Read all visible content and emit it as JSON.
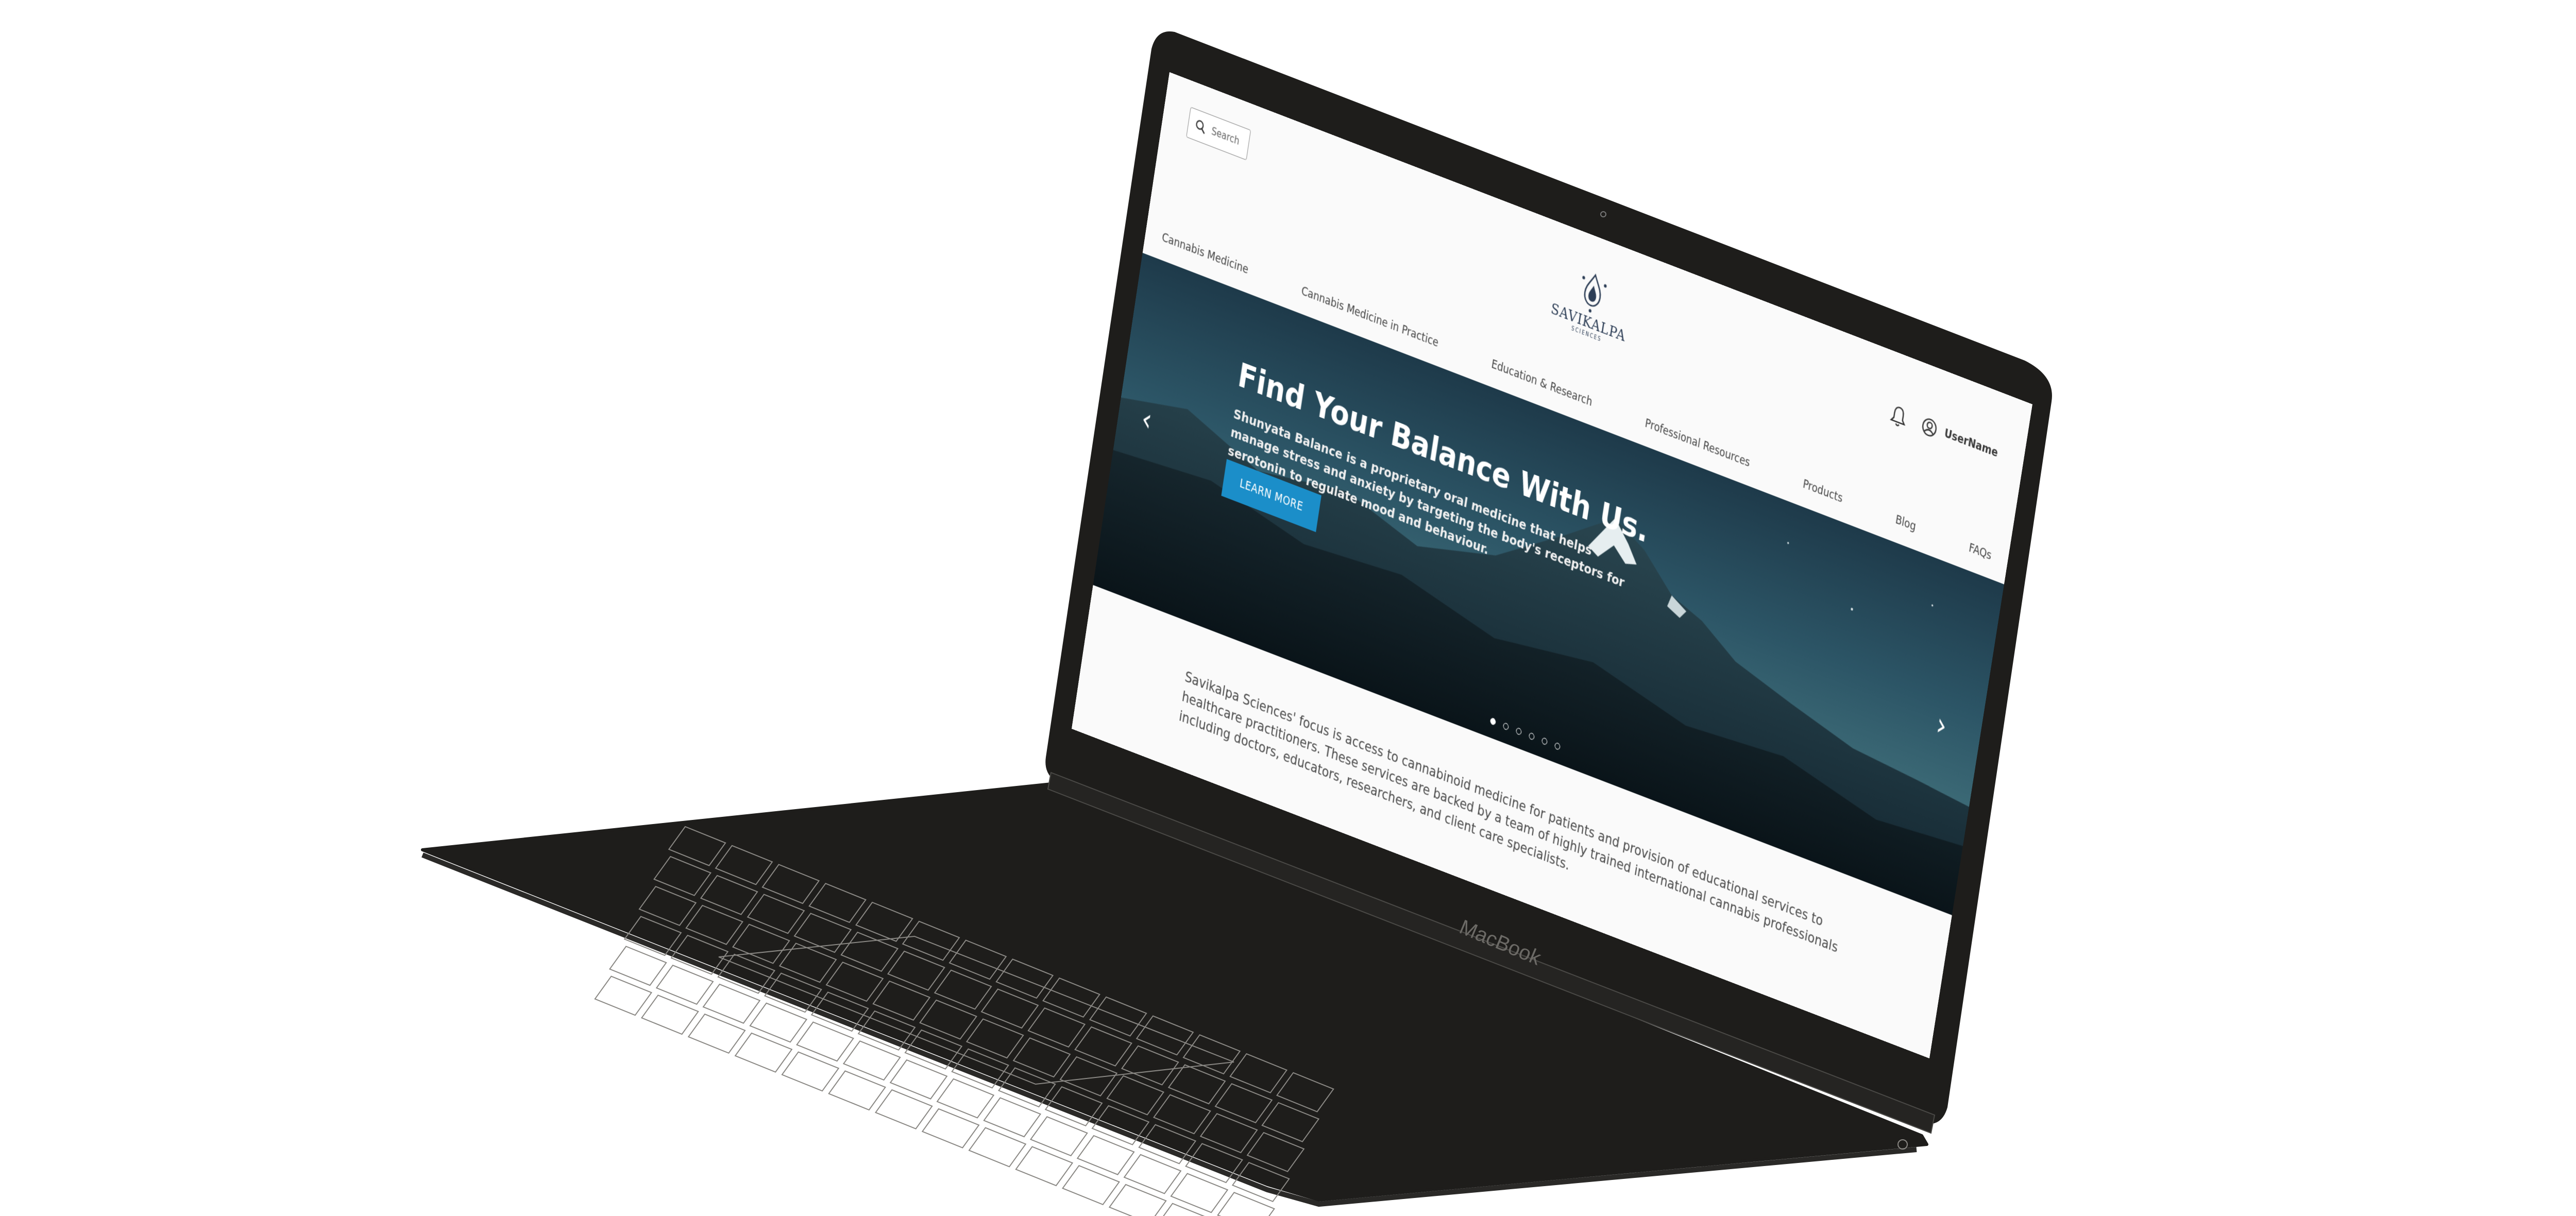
{
  "device": {
    "brand_label": "MacBook",
    "body_color": "#1e1d1b",
    "outline_color": "#8a8884"
  },
  "website": {
    "search": {
      "label": "Search",
      "icon": "search-icon"
    },
    "brand": {
      "name": "SAVIKALPA",
      "tagline": "SCIENCES"
    },
    "icons": {
      "notifications": "bell-icon",
      "account": "user-circle-icon"
    },
    "user": {
      "name": "UserName"
    },
    "nav": [
      {
        "label": "Cannabis Medicine"
      },
      {
        "label": "Cannabis Medicine in Practice"
      },
      {
        "label": "Education & Research"
      },
      {
        "label": "Professional Resources"
      },
      {
        "label": "Products"
      },
      {
        "label": "Blog"
      },
      {
        "label": "FAQs"
      }
    ],
    "hero": {
      "title": "Find Your Balance With Us.",
      "subtitle": "Shunyata Balance is a proprietary oral medicine that helps manage stress and anxiety by targeting the body's receptors for serotonin to regulate mood and behaviour.",
      "cta_label": "LEARN MORE",
      "cta_color": "#1b8ec9",
      "prev_glyph": "‹",
      "next_glyph": "›",
      "slide_count": 6,
      "active_slide": 1
    },
    "intro": "Savikalpa Sciences' focus is access to cannabinoid medicine for patients and provision of educational services to healthcare practitioners. These services are backed by a team of highly trained international cannabis professionals including doctors, educators, researchers, and client care specialists."
  }
}
